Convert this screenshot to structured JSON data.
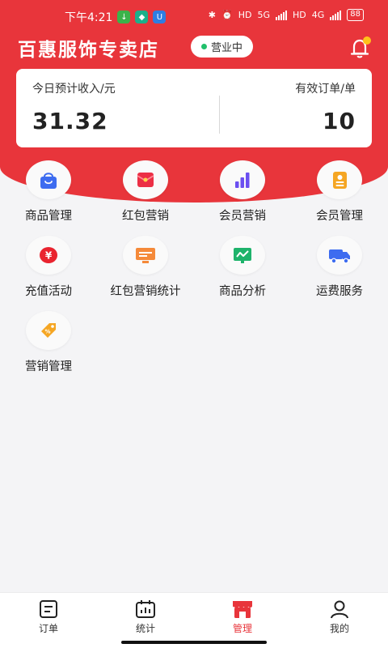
{
  "status_bar": {
    "time": "下午4:21",
    "network_5g": "5G",
    "network_4g": "4G",
    "hd1": "HD",
    "hd2": "HD",
    "battery": "88"
  },
  "header": {
    "store_name": "百惠服饰专卖店",
    "status_label": "营业中",
    "status_color": "#21c06b",
    "bell_icon": "bell-icon"
  },
  "stats": {
    "income_label": "今日预计收入/元",
    "income_value": "31.32",
    "orders_label": "有效订单/单",
    "orders_value": "10"
  },
  "menu": [
    {
      "label": "商品管理",
      "icon": "shopping-bag-icon"
    },
    {
      "label": "红包营销",
      "icon": "red-envelope-icon"
    },
    {
      "label": "会员营销",
      "icon": "bar-chart-icon"
    },
    {
      "label": "会员管理",
      "icon": "member-card-icon"
    },
    {
      "label": "充值活动",
      "icon": "yuan-coin-icon"
    },
    {
      "label": "红包营销统计",
      "icon": "monitor-stats-icon"
    },
    {
      "label": "商品分析",
      "icon": "trend-board-icon"
    },
    {
      "label": "运费服务",
      "icon": "truck-icon"
    },
    {
      "label": "营销管理",
      "icon": "discount-tag-icon"
    }
  ],
  "bottom_nav": [
    {
      "label": "订单",
      "icon": "order-list-icon",
      "active": false
    },
    {
      "label": "统计",
      "icon": "statistics-icon",
      "active": false
    },
    {
      "label": "管理",
      "icon": "shop-icon",
      "active": true
    },
    {
      "label": "我的",
      "icon": "profile-icon",
      "active": false
    }
  ],
  "colors": {
    "brand_red": "#e8353b",
    "background": "#f4f4f6"
  }
}
